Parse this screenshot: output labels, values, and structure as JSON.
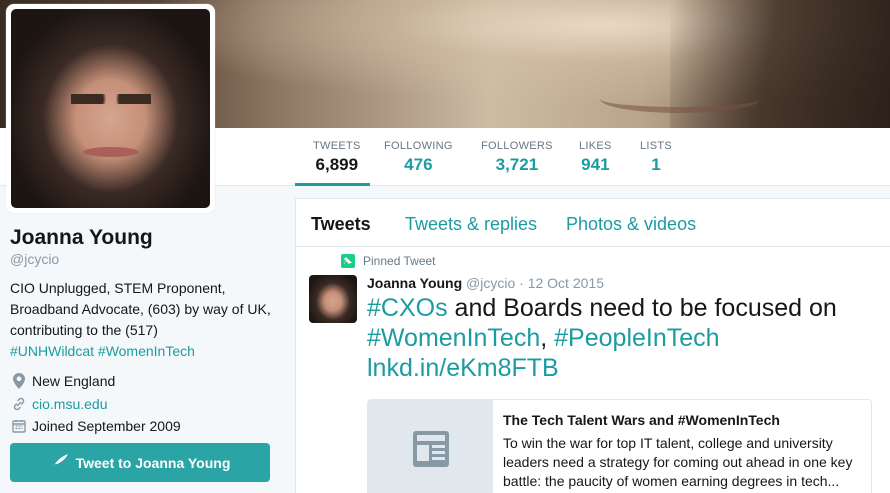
{
  "profile": {
    "name": "Joanna Young",
    "handle": "@jcycio",
    "bio_text": "CIO Unplugged, STEM Proponent, Broadband Advocate, (603) by way of UK, contributing to the (517)",
    "bio_hashtags": "#UNHWildcat #WomenInTech",
    "location": "New England",
    "website": "cio.msu.edu",
    "joined": "Joined September 2009",
    "tweet_to_button": "Tweet to Joanna Young"
  },
  "stats": [
    {
      "label": "TWEETS",
      "value": "6,899"
    },
    {
      "label": "FOLLOWING",
      "value": "476"
    },
    {
      "label": "FOLLOWERS",
      "value": "3,721"
    },
    {
      "label": "LIKES",
      "value": "941"
    },
    {
      "label": "LISTS",
      "value": "1"
    }
  ],
  "tabs": [
    "Tweets",
    "Tweets & replies",
    "Photos & videos"
  ],
  "tweet": {
    "pinned_label": "Pinned Tweet",
    "author": "Joanna Young",
    "handle": "@jcycio",
    "date": "· 12 Oct 2015",
    "text_tag1": "#CXOs",
    "text_mid": " and Boards need to be focused on ",
    "text_tag2": "#WomenInTech",
    "text_comma": ", ",
    "text_tag3": "#PeopleInTech",
    "text_link": "lnkd.in/eKm8FTB"
  },
  "card": {
    "title": "The Tech Talent Wars and #WomenInTech",
    "description": "To win the war for top IT talent, college and university leaders need a strategy for coming out ahead in one key battle: the paucity of women earning degrees in tech..."
  },
  "colors": {
    "accent": "#1b9ca1",
    "button": "#2aa4a5",
    "pinned": "#19cf86"
  }
}
